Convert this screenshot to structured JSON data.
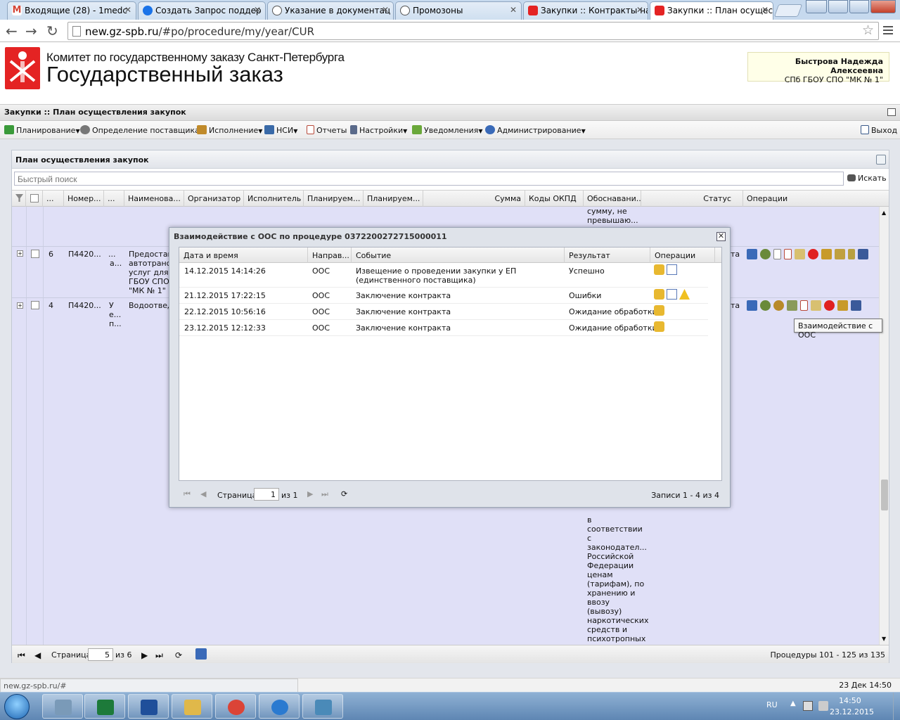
{
  "browser": {
    "tabs": [
      {
        "label": "Входящие (28) - 1medc",
        "color": "#d44638"
      },
      {
        "label": "Создать Запрос поддер",
        "color": "#1a73e8"
      },
      {
        "label": "Указание в документац",
        "color": "#333333"
      },
      {
        "label": "Промозоны",
        "color": "#333333"
      },
      {
        "label": "Закупки :: Контракты на",
        "color": "#a33"
      },
      {
        "label": "Закупки :: План осущес",
        "color": "#a33"
      }
    ],
    "url_host": "new.gz-spb.ru",
    "url_path": "/#po/procedure/my/year/CUR"
  },
  "header": {
    "org_line": "Комитет по государственному заказу Санкт-Петербурга",
    "title": "Государственный заказ",
    "user_name": "Быстрова Надежда Алексеевна",
    "user_org": "СПб ГБОУ СПО \"МК № 1\""
  },
  "module": {
    "title": "Закупки :: План осуществления закупок"
  },
  "toolbar": {
    "items": [
      {
        "label": "Планирование",
        "color": "#3a9a3a"
      },
      {
        "label": "Определение поставщика",
        "color": "#666666"
      },
      {
        "label": "Исполнение",
        "color": "#c08a2a"
      },
      {
        "label": "НСИ",
        "color": "#3a6aa8"
      },
      {
        "label": "Отчеты",
        "color": "#b84a3a"
      },
      {
        "label": "Настройки",
        "color": "#5a6a8a"
      },
      {
        "label": "Уведомления",
        "color": "#6aa83a"
      },
      {
        "label": "Администрирование",
        "color": "#3a6ab8"
      }
    ],
    "exit_label": "Выход"
  },
  "panel": {
    "title": "План осуществления закупок",
    "search_placeholder": "Быстрый поиск",
    "search_button": "Искать"
  },
  "grid": {
    "columns": [
      "...",
      "Номер...",
      "...",
      "Наименова...",
      "Организатор",
      "Исполнитель",
      "Планируем...",
      "Планируем...",
      "Сумма",
      "Коды ОКПД",
      "Обоснавани...",
      "Статус",
      "Операции"
    ],
    "top_partial": [
      "сумму, не",
      "превышаю..."
    ],
    "rows": [
      {
        "num": "6",
        "code": "П4420...",
        "col3": [
          "...",
          "а..."
        ],
        "name": [
          "Предостав",
          "автотрансп",
          "услуг для С",
          "ГБОУ СПО",
          "\"МК № 1\""
        ],
        "status_frag": "та"
      },
      {
        "num": "4",
        "code": "П4420...",
        "col3": [
          "У",
          "е...",
          "п..."
        ],
        "name": [
          "Водоотведе"
        ],
        "status_frag": "та"
      }
    ],
    "justification_tail": [
      "в",
      "соответствии",
      "с",
      "законодател...",
      "Российской",
      "Федерации",
      "ценам",
      "(тарифам), по",
      "хранению и",
      "ввозу",
      "(вывозу)",
      "наркотических",
      "средств и",
      "психотропных"
    ],
    "pager": {
      "page_label": "Страница",
      "page": "5",
      "of_label": "из 6",
      "records": "Процедуры 101 - 125 из 135"
    },
    "tooltip": "Взаимодействие с ООС"
  },
  "dialog": {
    "title": "Взаимодействие с ООС по процедуре 0372200272715000011",
    "columns": [
      "Дата и время",
      "Направ...",
      "Событие",
      "Результат",
      "Операции"
    ],
    "rows": [
      {
        "datetime": "14.12.2015 14:14:26",
        "direction": "ООС",
        "event": "Извещение о проведении закупки у ЕП (единственного поставщика)",
        "result": "Успешно",
        "ops": [
          "package-icon",
          "document-edit-icon"
        ]
      },
      {
        "datetime": "21.12.2015 17:22:15",
        "direction": "ООС",
        "event": "Заключение контракта",
        "result": "Ошибки",
        "ops": [
          "package-icon",
          "document-edit-icon",
          "warning-icon"
        ]
      },
      {
        "datetime": "22.12.2015 10:56:16",
        "direction": "ООС",
        "event": "Заключение контракта",
        "result": "Ожидание обработки",
        "ops": [
          "package-icon"
        ]
      },
      {
        "datetime": "23.12.2015 12:12:33",
        "direction": "ООС",
        "event": "Заключение контракта",
        "result": "Ожидание обработки",
        "ops": [
          "package-icon"
        ]
      }
    ],
    "pager": {
      "page_label": "Страница",
      "page": "1",
      "of_label": "из 1",
      "records": "Записи 1 - 4 из 4"
    }
  },
  "statusbar": {
    "url": "new.gz-spb.ru/#",
    "date": "23 Дек 14:50"
  },
  "taskbar": {
    "lang": "RU",
    "time": "14:50",
    "date": "23.12.2015",
    "apps": [
      {
        "name": "calculator",
        "color": "#7a9ab8"
      },
      {
        "name": "excel",
        "color": "#1d7a3a"
      },
      {
        "name": "word",
        "color": "#1f4f9a"
      },
      {
        "name": "explorer",
        "color": "#e0b84a"
      },
      {
        "name": "chrome",
        "color": "#db4437"
      },
      {
        "name": "internet-explorer",
        "color": "#2a7ad0"
      },
      {
        "name": "photos",
        "color": "#4a8ab8"
      }
    ]
  }
}
